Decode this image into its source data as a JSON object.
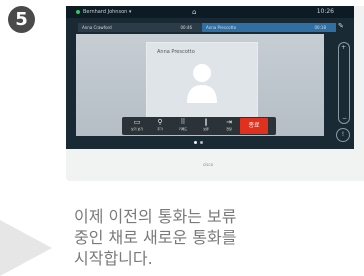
{
  "step": "5",
  "status": {
    "user": "Bernhard Johnson",
    "right": "10:26"
  },
  "calls": {
    "held": {
      "name": "Anna Crawford",
      "time": "00:46"
    },
    "active": {
      "name": "Anna Prescotto",
      "time": "00:18"
    }
  },
  "remote_name": "Anna Prescotto",
  "toolbar": [
    {
      "icon": "present-icon",
      "label": "보기 보기"
    },
    {
      "icon": "add-participant-icon",
      "label": "추가"
    },
    {
      "icon": "keypad-icon",
      "label": "키패드"
    },
    {
      "icon": "hold-icon",
      "label": "보류"
    },
    {
      "icon": "transfer-icon",
      "label": "전달"
    }
  ],
  "end_call": "종료",
  "brand": "cisco",
  "caption_lines": [
    "이제 이전의 통화는 보류",
    "중인 채로 새로운 통화를",
    "시작합니다."
  ],
  "colors": {
    "end": "#e0301e",
    "active_call": "#2f6fa3",
    "screen_bg": "#1a2a35"
  }
}
